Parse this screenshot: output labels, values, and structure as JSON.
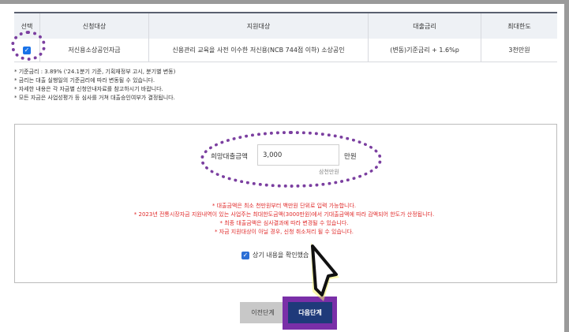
{
  "table": {
    "headers": [
      "선택",
      "신청대상",
      "지원대상",
      "대출금리",
      "최대한도"
    ],
    "row": {
      "name": "저신용소상공인자금",
      "target": "신용관리 교육을 사전 이수한 저신용(NCB 744점 이하) 소상공인",
      "rate": "(변동)기준금리 + 1.6%p",
      "limit": "3천만원"
    }
  },
  "notes": [
    "* 기준금리 : 3.89% ('24.1분기 기준, 기획재정부 고시, 분기별 변동)",
    "* 금리는 대출 실행일의 기준금리에 따라 변동될 수 있습니다.",
    "* 자세한 내용은 각 자금별 신청안내자료를 참고하시기 바랍니다.",
    "* 모든 자금은 사업성평가 등 심사를 거쳐 대출승인여부가 결정됩니다."
  ],
  "amount": {
    "label": "희망대출금액",
    "value": "3,000",
    "unit": "만원",
    "korean": "삼천만원"
  },
  "warnings": [
    "* 대출금액은 최소 천만원부터 백만원 단위로 입력 가능합니다.",
    "* 2023년 전통시장자금 지원내역이 있는 사업주는 최대한도금액(3000만원)에서 기대출금액에 따라 감액되어 한도가 산정됩니다.",
    "* 최종 대출금액은 심사결과에 따라 변경될 수 있습니다.",
    "* 자금 지원대상이 아닐 경우, 신청 취소처리 될 수 있습니다."
  ],
  "confirm_label": "상기 내용을 확인했습",
  "buttons": {
    "prev": "이전단계",
    "next": "다음단계"
  },
  "colors": {
    "annotation": "#7b3fa0",
    "warning": "#e02a2a",
    "next_button": "#1f3a7a",
    "checkbox": "#1a73e8"
  },
  "icons": {
    "checked": "checkbox-checked-icon",
    "cursor": "mouse-pointer-icon"
  }
}
